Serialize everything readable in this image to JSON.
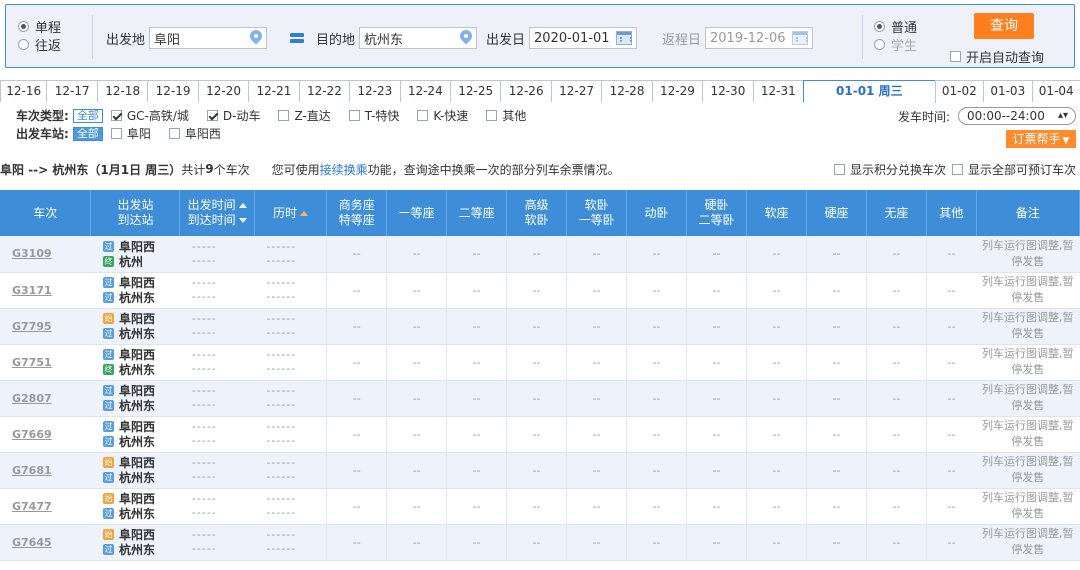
{
  "search": {
    "trip_types": [
      {
        "label": "单程",
        "checked": true
      },
      {
        "label": "往返",
        "checked": false
      }
    ],
    "from_label": "出发地",
    "from_value": "阜阳",
    "to_label": "目的地",
    "to_value": "杭州东",
    "depart_label": "出发日",
    "depart_value": "2020-01-01",
    "return_label": "返程日",
    "return_value": "2019-12-06",
    "passenger_types": [
      {
        "label": "普通",
        "checked": true
      },
      {
        "label": "学生",
        "checked": false
      }
    ],
    "query_label": "查询",
    "auto_query_label": "开启自动查询"
  },
  "date_tabs": [
    "12-16",
    "12-17",
    "12-18",
    "12-19",
    "12-20",
    "12-21",
    "12-22",
    "12-23",
    "12-24",
    "12-25",
    "12-26",
    "12-27",
    "12-28",
    "12-29",
    "12-30",
    "12-31",
    "01-01 周三",
    "01-02",
    "01-03",
    "01-04"
  ],
  "active_date_tab": "01-01 周三",
  "filters": {
    "type_label": "车次类型:",
    "all_label": "全部",
    "types": [
      {
        "label": "GC-高铁/城",
        "checked": true
      },
      {
        "label": "D-动车",
        "checked": true
      },
      {
        "label": "Z-直达",
        "checked": false
      },
      {
        "label": "T-特快",
        "checked": false
      },
      {
        "label": "K-快速",
        "checked": false
      },
      {
        "label": "其他",
        "checked": false
      }
    ],
    "station_label": "出发车站:",
    "stations": [
      {
        "label": "阜阳",
        "checked": false
      },
      {
        "label": "阜阳西",
        "checked": false
      }
    ],
    "depart_time_label": "发车时间:",
    "depart_time_value": "00:00--24:00",
    "helper_label": "订票帮手"
  },
  "summary": {
    "route": "阜阳 --> 杭州东（1月1日 周三）",
    "count_prefix": "共计",
    "count": "9",
    "count_suffix": "个车次",
    "note_prefix": "您可使用",
    "note_link": "接续换乘",
    "note_suffix": "功能，查询途中换乘一次的部分列车余票情况。",
    "option_points": "显示积分兑换车次",
    "option_all": "显示全部可预订车次"
  },
  "table": {
    "headers": {
      "train": "车次",
      "station_top": "出发站",
      "station_bottom": "到达站",
      "time_top": "出发时间",
      "time_bottom": "到达时间",
      "duration": "历时",
      "business_top": "商务座",
      "business_bottom": "特等座",
      "first": "一等座",
      "second": "二等座",
      "soft_top": "高级",
      "soft_bottom": "软卧",
      "softsleep_top": "软卧",
      "softsleep_bottom": "一等卧",
      "dongwo": "动卧",
      "hard_top": "硬卧",
      "hard_bottom": "二等卧",
      "softseat": "软座",
      "hardseat": "硬座",
      "noseat": "无座",
      "other": "其他",
      "remark": "备注"
    },
    "placeholder_time": "-----",
    "placeholder_dur": "------",
    "placeholder_seat": "--",
    "remark_text": "列车运行图调整,暂停发售",
    "rows": [
      {
        "train": "G3109",
        "from": "阜阳西",
        "from_icon": "pass",
        "to": "杭州",
        "to_icon": "end"
      },
      {
        "train": "G3171",
        "from": "阜阳西",
        "from_icon": "pass",
        "to": "杭州东",
        "to_icon": "pass"
      },
      {
        "train": "G7795",
        "from": "阜阳西",
        "from_icon": "start",
        "to": "杭州东",
        "to_icon": "pass"
      },
      {
        "train": "G7751",
        "from": "阜阳西",
        "from_icon": "pass",
        "to": "杭州东",
        "to_icon": "end"
      },
      {
        "train": "G2807",
        "from": "阜阳西",
        "from_icon": "pass",
        "to": "杭州东",
        "to_icon": "pass"
      },
      {
        "train": "G7669",
        "from": "阜阳西",
        "from_icon": "pass",
        "to": "杭州东",
        "to_icon": "pass"
      },
      {
        "train": "G7681",
        "from": "阜阳西",
        "from_icon": "start",
        "to": "杭州东",
        "to_icon": "pass"
      },
      {
        "train": "G7477",
        "from": "阜阳西",
        "from_icon": "start",
        "to": "杭州东",
        "to_icon": "pass"
      },
      {
        "train": "G7645",
        "from": "阜阳西",
        "from_icon": "start",
        "to": "杭州东",
        "to_icon": "pass"
      }
    ]
  },
  "icon_glyphs": {
    "pass": "过",
    "end": "终",
    "start": "始"
  },
  "colors": {
    "accent": "#3d8dd8",
    "orange": "#ff7f1f",
    "link": "#2a79d4"
  }
}
